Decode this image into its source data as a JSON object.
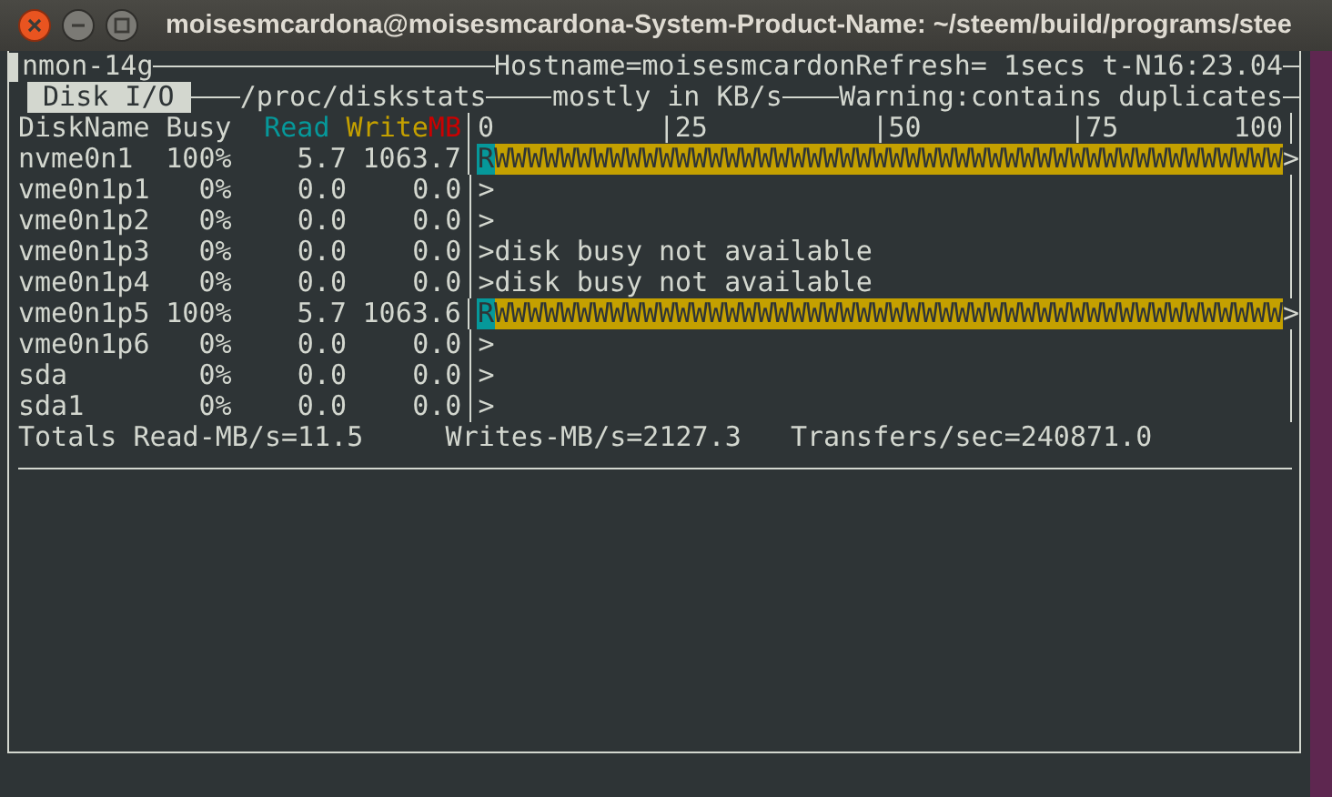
{
  "window": {
    "title": "moisesmcardona@moisesmcardona-System-Product-Name: ~/steem/build/programs/stee"
  },
  "header": {
    "program": "nmon-14g",
    "status": "Hostname=moisesmcardonRefresh= 1secs t-N16:23.04"
  },
  "panel": {
    "tab": "Disk I/O",
    "source": "/proc/diskstats",
    "units": "mostly in KB/s",
    "warning": "Warning:contains duplicates"
  },
  "columns": {
    "name": "DiskName",
    "busy": "Busy",
    "read": "Read",
    "write": "Write",
    "unit": "MB",
    "scale": "0          |25          |50         |75       100"
  },
  "rows": [
    {
      "kind": "bar",
      "name": "nvme0n1",
      "busy": "100%",
      "read": "5.7",
      "write": "1063.7",
      "read_bar": "R",
      "write_bar": "WWWWWWWWWWWWWWWWWWWWWWWWWWWWWWWWWWWWWWWWWWWWWWWW",
      "end": ">"
    },
    {
      "kind": "text",
      "name": "vme0n1p1",
      "busy": "0%",
      "read": "0.0",
      "write": "0.0",
      "graph": ">"
    },
    {
      "kind": "text",
      "name": "vme0n1p2",
      "busy": "0%",
      "read": "0.0",
      "write": "0.0",
      "graph": ">"
    },
    {
      "kind": "text",
      "name": "vme0n1p3",
      "busy": "0%",
      "read": "0.0",
      "write": "0.0",
      "graph": ">disk busy not available"
    },
    {
      "kind": "text",
      "name": "vme0n1p4",
      "busy": "0%",
      "read": "0.0",
      "write": "0.0",
      "graph": ">disk busy not available"
    },
    {
      "kind": "bar",
      "name": "vme0n1p5",
      "busy": "100%",
      "read": "5.7",
      "write": "1063.6",
      "read_bar": "R",
      "write_bar": "WWWWWWWWWWWWWWWWWWWWWWWWWWWWWWWWWWWWWWWWWWWWWWWW",
      "end": ">"
    },
    {
      "kind": "text",
      "name": "vme0n1p6",
      "busy": "0%",
      "read": "0.0",
      "write": "0.0",
      "graph": ">"
    },
    {
      "kind": "text",
      "name": "sda",
      "busy": "0%",
      "read": "0.0",
      "write": "0.0",
      "graph": ">"
    },
    {
      "kind": "text",
      "name": "sda1",
      "busy": "0%",
      "read": "0.0",
      "write": "0.0",
      "graph": ">"
    }
  ],
  "totals": [
    "Totals Read-MB/s=11.5",
    "Writes-MB/s=2127.3",
    "Transfers/sec=240871.0"
  ]
}
